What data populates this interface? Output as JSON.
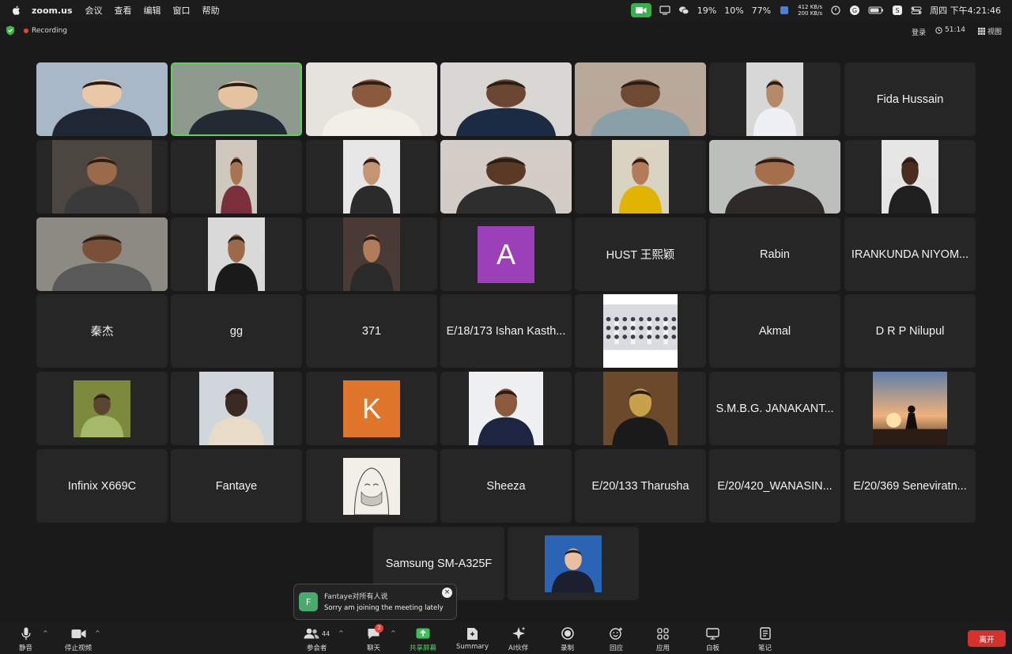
{
  "menubar": {
    "app_name": "zoom.us",
    "menus": [
      "会议",
      "查看",
      "编辑",
      "窗口",
      "帮助"
    ],
    "cpu": "19%",
    "mem": "10%",
    "battery": "77%",
    "net_up": "412 KB/s",
    "net_down": "200 KB/s",
    "clock": "周四 下午4:21:46"
  },
  "topbar": {
    "recording": "Recording",
    "login": "登录",
    "elapsed": "51:14",
    "view": "视图"
  },
  "tiles": [
    {
      "name": "",
      "type": "video"
    },
    {
      "name": "",
      "type": "video",
      "speaking": true
    },
    {
      "name": "",
      "type": "video"
    },
    {
      "name": "",
      "type": "video"
    },
    {
      "name": "",
      "type": "video"
    },
    {
      "name": "",
      "type": "video"
    },
    {
      "name": "Fida Hussain",
      "type": "name"
    },
    {
      "name": "",
      "type": "video"
    },
    {
      "name": "",
      "type": "video"
    },
    {
      "name": "",
      "type": "video"
    },
    {
      "name": "",
      "type": "video"
    },
    {
      "name": "",
      "type": "video"
    },
    {
      "name": "",
      "type": "video"
    },
    {
      "name": "",
      "type": "video"
    },
    {
      "name": "",
      "type": "video"
    },
    {
      "name": "",
      "type": "video"
    },
    {
      "name": "",
      "type": "video"
    },
    {
      "name": "A",
      "type": "letter",
      "color": "#9b40b8"
    },
    {
      "name": "HUST 王熙颖",
      "type": "name"
    },
    {
      "name": "Rabin",
      "type": "name"
    },
    {
      "name": "IRANKUNDA NIYOM...",
      "type": "name"
    },
    {
      "name": "秦杰",
      "type": "name"
    },
    {
      "name": "gg",
      "type": "name"
    },
    {
      "name": "371",
      "type": "name"
    },
    {
      "name": "E/18/173 Ishan Kasth...",
      "type": "name"
    },
    {
      "name": "",
      "type": "photo"
    },
    {
      "name": "Akmal",
      "type": "name"
    },
    {
      "name": "D R P Nilupul",
      "type": "name"
    },
    {
      "name": "",
      "type": "photo"
    },
    {
      "name": "",
      "type": "photo"
    },
    {
      "name": "K",
      "type": "letter",
      "color": "#e0752c"
    },
    {
      "name": "",
      "type": "photo"
    },
    {
      "name": "",
      "type": "photo"
    },
    {
      "name": "S.M.B.G. JANAKANT...",
      "type": "name"
    },
    {
      "name": "",
      "type": "photo"
    },
    {
      "name": "Infinix X669C",
      "type": "name"
    },
    {
      "name": "Fantaye",
      "type": "name"
    },
    {
      "name": "",
      "type": "photo"
    },
    {
      "name": "Sheeza",
      "type": "name"
    },
    {
      "name": "E/20/133 Tharusha",
      "type": "name"
    },
    {
      "name": "E/20/420_WANASIN...",
      "type": "name"
    },
    {
      "name": "E/20/369 Seneviratn...",
      "type": "name"
    },
    {
      "name": "Samsung SM-A325F",
      "type": "name"
    },
    {
      "name": "",
      "type": "photo"
    }
  ],
  "chat_toast": {
    "avatar_letter": "F",
    "from": "Fantaye对所有人说",
    "message": "Sorry am joining the meeting lately",
    "close": "×"
  },
  "toolbar": {
    "mute": "静音",
    "stop_video": "停止视频",
    "participants": "参会者",
    "participants_count": "44",
    "chat": "聊天",
    "chat_badge": "2",
    "share": "共享屏幕",
    "summary": "Summary",
    "ai": "AI伙伴",
    "record": "录制",
    "reactions": "回应",
    "apps": "应用",
    "whiteboard": "白板",
    "notes": "笔记",
    "leave": "离开"
  },
  "colors": {
    "accent_green": "#4cd964",
    "leave_red": "#d8302a",
    "tile_bg": "#262626"
  }
}
